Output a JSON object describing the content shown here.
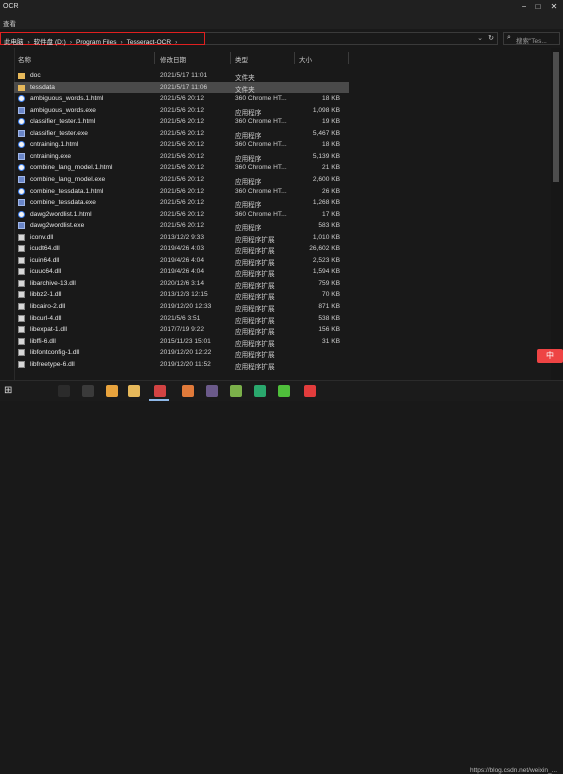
{
  "window": {
    "title": "OCR"
  },
  "ribbon": {
    "tab": "查看"
  },
  "address": {
    "crumbs": [
      "此电脑",
      "软件盘 (D:)",
      "Program Files",
      "Tesseract-OCR"
    ],
    "search_placeholder": "搜索\"Tes..."
  },
  "columns": {
    "name": "名称",
    "date": "修改日期",
    "type": "类型",
    "size": "大小"
  },
  "files": [
    {
      "name": "doc",
      "date": "2021/5/17 11:01",
      "type": "文件夹",
      "size": "",
      "icon": "folder-icon"
    },
    {
      "name": "tessdata",
      "date": "2021/5/17 11:06",
      "type": "文件夹",
      "size": "",
      "icon": "folder-icon",
      "selected": true
    },
    {
      "name": "ambiguous_words.1.html",
      "date": "2021/5/6 20:12",
      "type": "360 Chrome HT...",
      "size": "18 KB",
      "icon": "html-icon"
    },
    {
      "name": "ambiguous_words.exe",
      "date": "2021/5/6 20:12",
      "type": "应用程序",
      "size": "1,098 KB",
      "icon": "exe-icon"
    },
    {
      "name": "classifier_tester.1.html",
      "date": "2021/5/6 20:12",
      "type": "360 Chrome HT...",
      "size": "19 KB",
      "icon": "html-icon"
    },
    {
      "name": "classifier_tester.exe",
      "date": "2021/5/6 20:12",
      "type": "应用程序",
      "size": "5,467 KB",
      "icon": "exe-icon"
    },
    {
      "name": "cntraining.1.html",
      "date": "2021/5/6 20:12",
      "type": "360 Chrome HT...",
      "size": "18 KB",
      "icon": "html-icon"
    },
    {
      "name": "cntraining.exe",
      "date": "2021/5/6 20:12",
      "type": "应用程序",
      "size": "5,139 KB",
      "icon": "exe-icon"
    },
    {
      "name": "combine_lang_model.1.html",
      "date": "2021/5/6 20:12",
      "type": "360 Chrome HT...",
      "size": "21 KB",
      "icon": "html-icon"
    },
    {
      "name": "combine_lang_model.exe",
      "date": "2021/5/6 20:12",
      "type": "应用程序",
      "size": "2,600 KB",
      "icon": "exe-icon"
    },
    {
      "name": "combine_tessdata.1.html",
      "date": "2021/5/6 20:12",
      "type": "360 Chrome HT...",
      "size": "26 KB",
      "icon": "html-icon"
    },
    {
      "name": "combine_tessdata.exe",
      "date": "2021/5/6 20:12",
      "type": "应用程序",
      "size": "1,268 KB",
      "icon": "exe-icon"
    },
    {
      "name": "dawg2wordlist.1.html",
      "date": "2021/5/6 20:12",
      "type": "360 Chrome HT...",
      "size": "17 KB",
      "icon": "html-icon"
    },
    {
      "name": "dawg2wordlist.exe",
      "date": "2021/5/6 20:12",
      "type": "应用程序",
      "size": "583 KB",
      "icon": "exe-icon"
    },
    {
      "name": "iconv.dll",
      "date": "2013/12/2 9:33",
      "type": "应用程序扩展",
      "size": "1,010 KB",
      "icon": "dll-icon"
    },
    {
      "name": "icudt64.dll",
      "date": "2019/4/26 4:03",
      "type": "应用程序扩展",
      "size": "26,602 KB",
      "icon": "dll-icon"
    },
    {
      "name": "icuin64.dll",
      "date": "2019/4/26 4:04",
      "type": "应用程序扩展",
      "size": "2,523 KB",
      "icon": "dll-icon"
    },
    {
      "name": "icuuc64.dll",
      "date": "2019/4/26 4:04",
      "type": "应用程序扩展",
      "size": "1,594 KB",
      "icon": "dll-icon"
    },
    {
      "name": "libarchive-13.dll",
      "date": "2020/12/6 3:14",
      "type": "应用程序扩展",
      "size": "759 KB",
      "icon": "dll-icon"
    },
    {
      "name": "libbz2-1.dll",
      "date": "2013/12/3 12:15",
      "type": "应用程序扩展",
      "size": "70 KB",
      "icon": "dll-icon"
    },
    {
      "name": "libcairo-2.dll",
      "date": "2019/12/20 12:33",
      "type": "应用程序扩展",
      "size": "871 KB",
      "icon": "dll-icon"
    },
    {
      "name": "libcurl-4.dll",
      "date": "2021/5/6 3:51",
      "type": "应用程序扩展",
      "size": "538 KB",
      "icon": "dll-icon"
    },
    {
      "name": "libexpat-1.dll",
      "date": "2017/7/19 9:22",
      "type": "应用程序扩展",
      "size": "156 KB",
      "icon": "dll-icon"
    },
    {
      "name": "libffi-6.dll",
      "date": "2015/11/23 15:01",
      "type": "应用程序扩展",
      "size": "31 KB",
      "icon": "dll-icon"
    },
    {
      "name": "libfontconfig-1.dll",
      "date": "2019/12/20 12:22",
      "type": "应用程序扩展",
      "size": "",
      "icon": "dll-icon"
    },
    {
      "name": "libfreetype-6.dll",
      "date": "2019/12/20 11:52",
      "type": "应用程序扩展",
      "size": "",
      "icon": "dll-icon"
    }
  ],
  "taskbar": {
    "apps": [
      {
        "name": "terminal-icon",
        "color": "#2b2b2b"
      },
      {
        "name": "app-icon-dark",
        "color": "#3a3a3a"
      },
      {
        "name": "chrome-icon",
        "color": "#e8a33d"
      },
      {
        "name": "file-explorer-icon",
        "color": "#e6b85a"
      },
      {
        "name": "red-app-icon",
        "color": "#d24343"
      },
      {
        "name": "orange-app-icon",
        "color": "#e07a3a"
      },
      {
        "name": "globe-icon",
        "color": "#6b5a8a"
      },
      {
        "name": "notepad-icon",
        "color": "#7bb04a"
      },
      {
        "name": "pycharm-icon",
        "color": "#2aa86d"
      },
      {
        "name": "wechat-icon",
        "color": "#4fbf3b"
      },
      {
        "name": "red-circle-app-icon",
        "color": "#e23c3c"
      }
    ],
    "watermark": "https://blog.csdn.net/weixin_..."
  },
  "ime_badge": "中"
}
